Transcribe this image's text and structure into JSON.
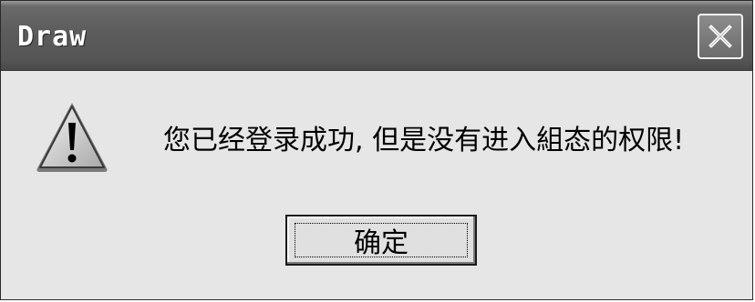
{
  "window": {
    "title": "Draw"
  },
  "dialog": {
    "message": "您已经登录成功, 但是没有进入組态的权限!",
    "icon": "warning-icon",
    "ok_label": "确定"
  },
  "colors": {
    "titlebar": "#5c5c5c",
    "client_bg": "#e6e6e6",
    "text": "#000000"
  }
}
